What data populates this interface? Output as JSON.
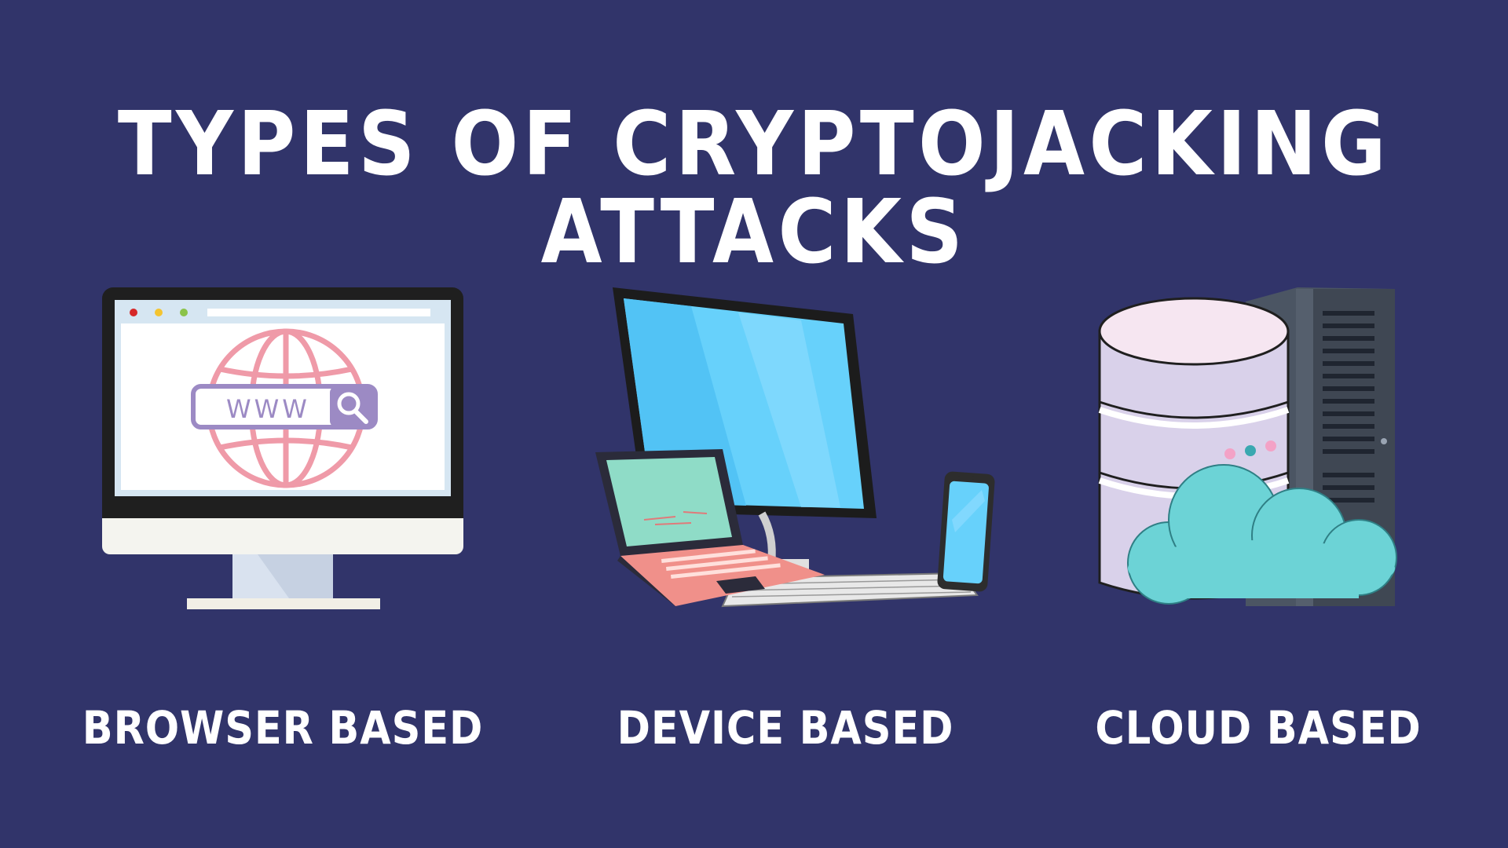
{
  "title": "TYPES OF CRYPTOJACKING ATTACKS",
  "www_text": "WWW",
  "categories": [
    {
      "label": "BROWSER BASED",
      "icon": "browser-monitor-icon"
    },
    {
      "label": "DEVICE BASED",
      "icon": "devices-icon"
    },
    {
      "label": "CLOUD BASED",
      "icon": "cloud-server-icon"
    }
  ],
  "colors": {
    "background": "#31346a",
    "text": "#ffffff",
    "globe": "#ef9aa8",
    "screen": "#67d1fb",
    "cloud": "#6cd3d6",
    "server": "#4b5563"
  }
}
